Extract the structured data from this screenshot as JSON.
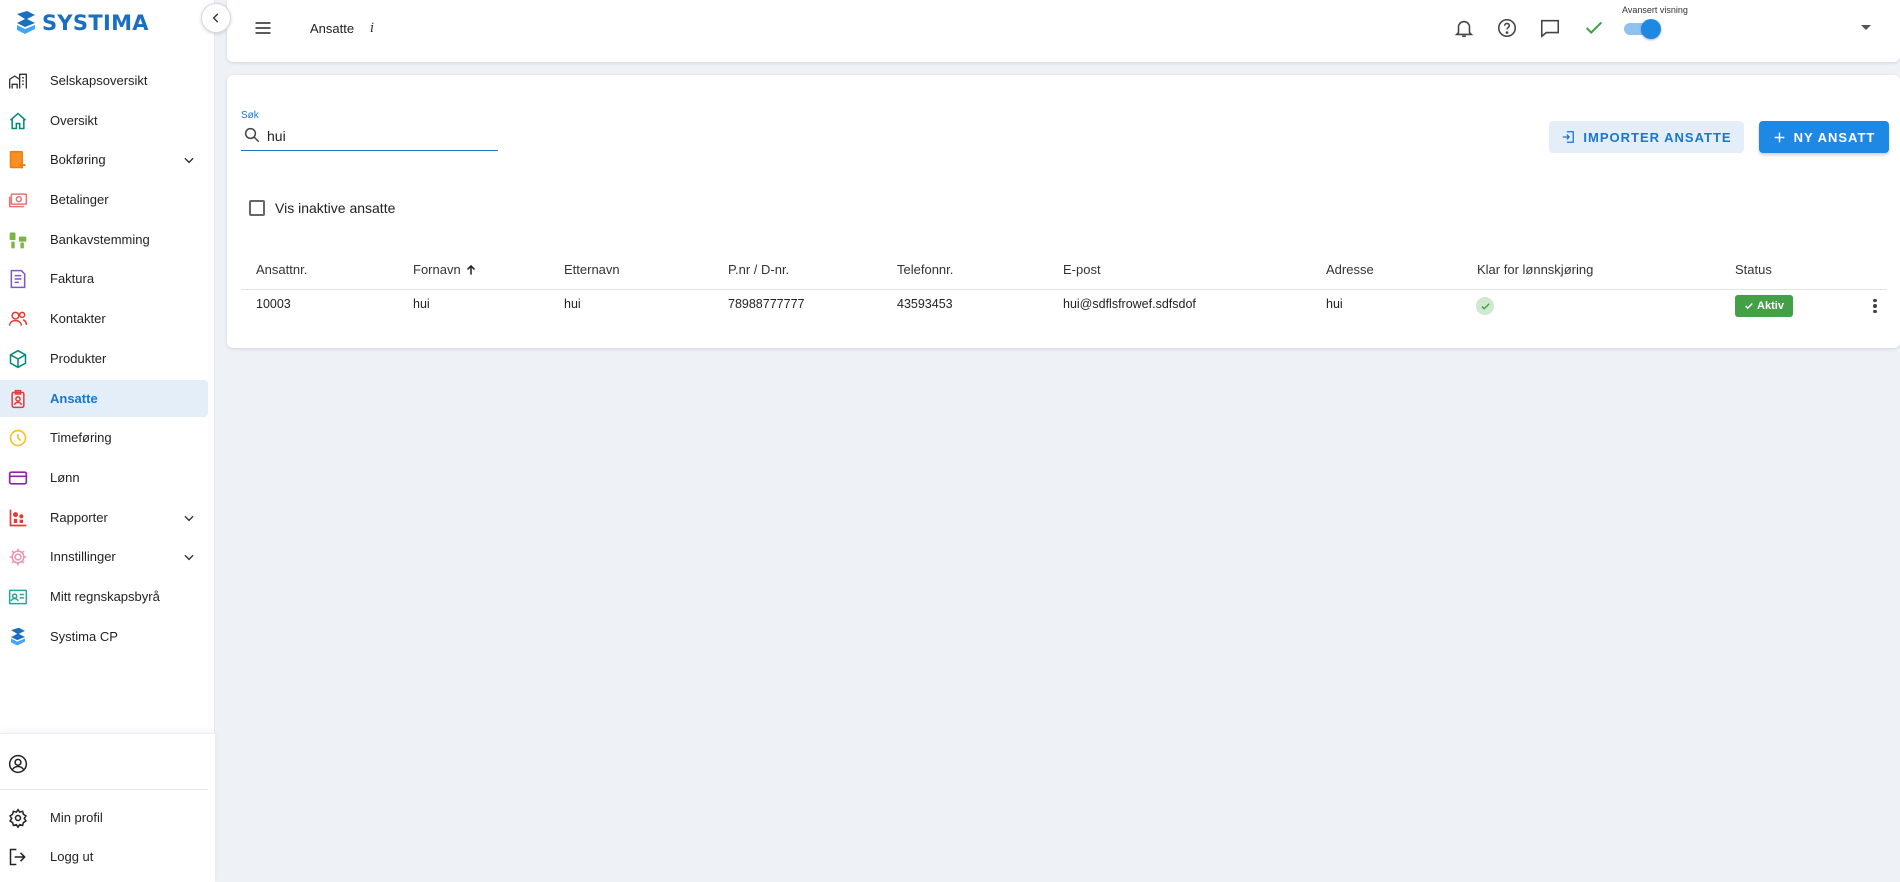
{
  "app": {
    "brand": "SYSTIMA",
    "brand_color": "#1b6fc1",
    "accent": "#1976d2"
  },
  "sidebar": {
    "items": [
      {
        "label": "Selskapsoversikt",
        "icon": "building-icon",
        "color": "#333333"
      },
      {
        "label": "Oversikt",
        "icon": "home-icon",
        "color": "#00897b"
      },
      {
        "label": "Bokføring",
        "icon": "ledger-icon",
        "color": "#f57c00",
        "expandable": true
      },
      {
        "label": "Betalinger",
        "icon": "banknote-icon",
        "color": "#e57373"
      },
      {
        "label": "Bankavstemming",
        "icon": "bank-reconcile-icon",
        "color": "#7cb342"
      },
      {
        "label": "Faktura",
        "icon": "invoice-icon",
        "color": "#7e57c2"
      },
      {
        "label": "Kontakter",
        "icon": "contacts-icon",
        "color": "#e53935"
      },
      {
        "label": "Produkter",
        "icon": "box-icon",
        "color": "#00897b"
      },
      {
        "label": "Ansatte",
        "icon": "badge-icon",
        "color": "#e53935",
        "active": true
      },
      {
        "label": "Timeføring",
        "icon": "clock-icon",
        "color": "#fbc02d"
      },
      {
        "label": "Lønn",
        "icon": "wallet-icon",
        "color": "#8e24aa"
      },
      {
        "label": "Rapporter",
        "icon": "report-icon",
        "color": "#e53935",
        "expandable": true
      },
      {
        "label": "Innstillinger",
        "icon": "gear-icon",
        "color": "#f48fb1",
        "expandable": true
      },
      {
        "label": "Mitt regnskapsbyrå",
        "icon": "id-card-icon",
        "color": "#26a69a"
      },
      {
        "label": "Systima CP",
        "icon": "systima-logo-icon",
        "color": "#1b6fc1"
      }
    ],
    "bottom": [
      {
        "label": "Min profil",
        "icon": "settings-icon"
      },
      {
        "label": "Logg ut",
        "icon": "logout-icon"
      }
    ]
  },
  "header": {
    "title": "Ansatte",
    "info": "i",
    "advanced_label": "Avansert visning",
    "advanced_on": true
  },
  "main": {
    "search_label": "Søk",
    "search_value": "hui",
    "import_button": "IMPORTER ANSATTE",
    "new_button": "NY ANSATT",
    "show_inactive": "Vis inaktive ansatte",
    "columns": [
      "Ansattnr.",
      "Fornavn",
      "Etternavn",
      "P.nr / D-nr.",
      "Telefonnr.",
      "E-post",
      "Adresse",
      "Klar for lønnskjøring",
      "Status"
    ],
    "sort_column": "Fornavn",
    "rows": [
      {
        "number": "10003",
        "first_name": "hui",
        "last_name": "hui",
        "pnr": "78988777777",
        "phone": "43593453",
        "email": "hui@sdflsfrowef.sdfsdof",
        "address": "hui",
        "payroll_ready": true,
        "status": "Aktiv",
        "status_color": "#43a047"
      }
    ]
  }
}
